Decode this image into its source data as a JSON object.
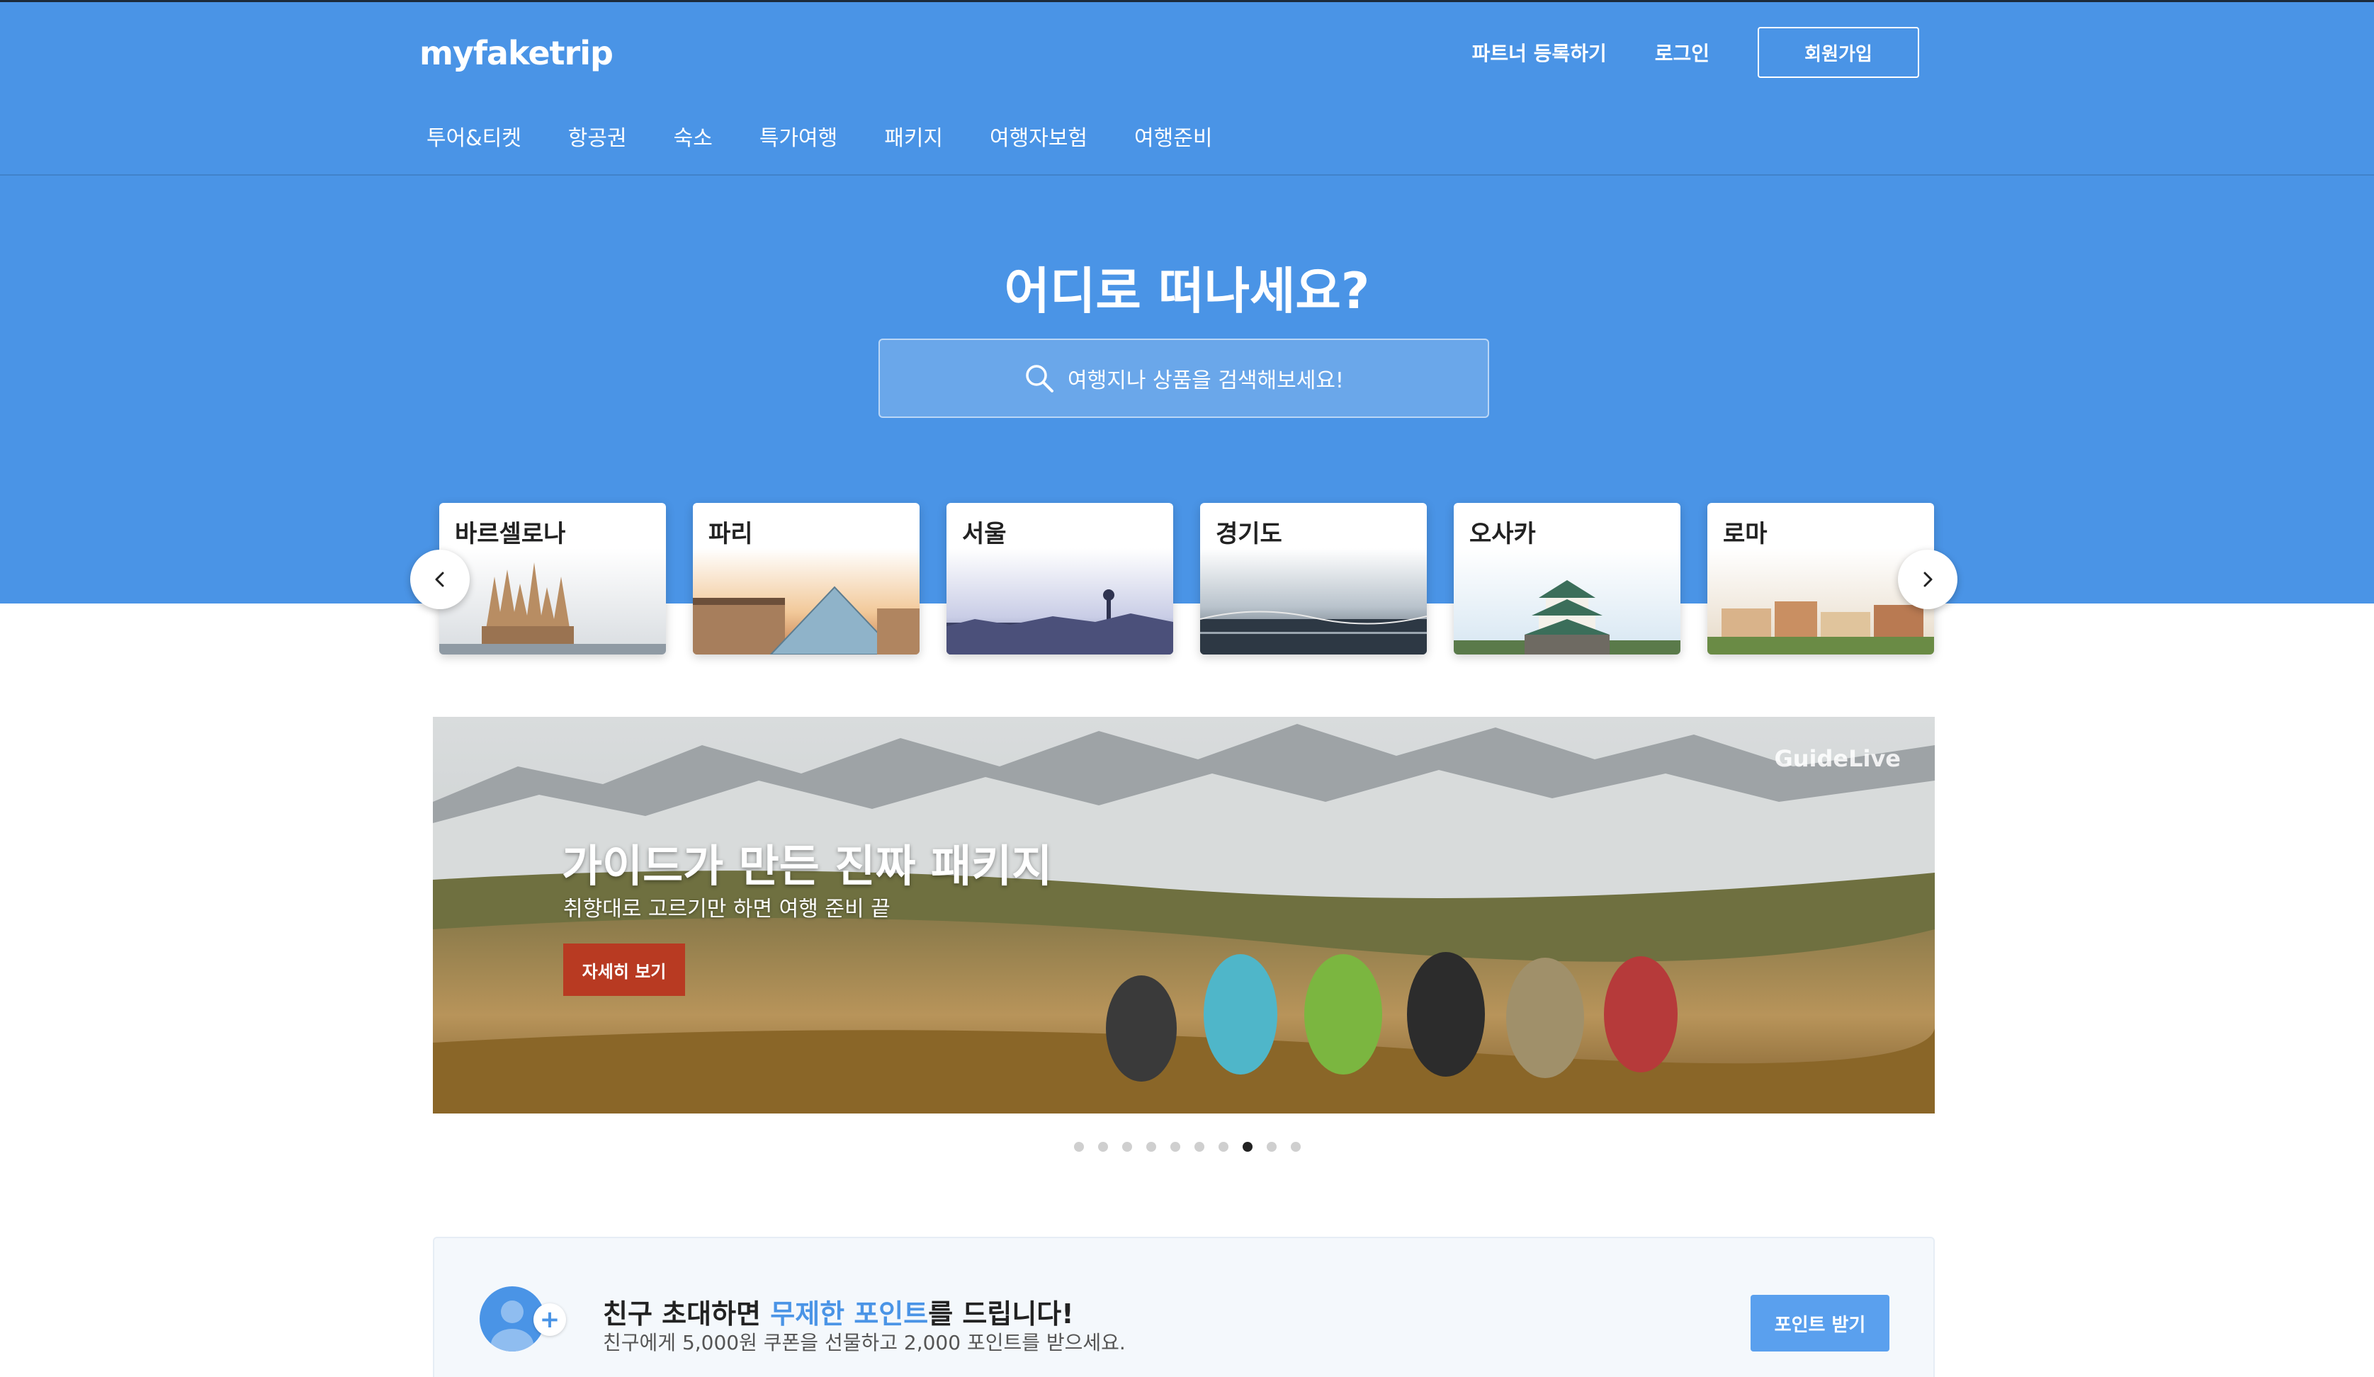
{
  "header": {
    "logo": "myfaketrip",
    "links": {
      "partner": "파트너 등록하기",
      "login": "로그인",
      "signup": "회원가입"
    }
  },
  "nav": {
    "items": [
      "투어&티켓",
      "항공권",
      "숙소",
      "특가여행",
      "패키지",
      "여행자보험",
      "여행준비"
    ]
  },
  "hero": {
    "title": "어디로 떠나세요?",
    "search_placeholder": "여행지나 상품을 검색해보세요!"
  },
  "cities": [
    "바르셀로나",
    "파리",
    "서울",
    "경기도",
    "오사카",
    "로마"
  ],
  "banner": {
    "brand": "GuideLive",
    "title": "가이드가 만든 진짜 패키지",
    "subtitle": "취향대로 고르기만 하면 여행 준비 끝",
    "button": "자세히 보기",
    "dots_total": 10,
    "dots_active": 8
  },
  "invite": {
    "title_prefix": "친구 초대하면 ",
    "title_highlight": "무제한 포인트",
    "title_suffix": "를 드립니다!",
    "subtitle": "친구에게 5,000원 쿠폰을 선물하고 2,000 포인트를 받으세요.",
    "button": "포인트 받기"
  },
  "colors": {
    "brand": "#4a94e6",
    "banner_button": "#b83a22"
  }
}
